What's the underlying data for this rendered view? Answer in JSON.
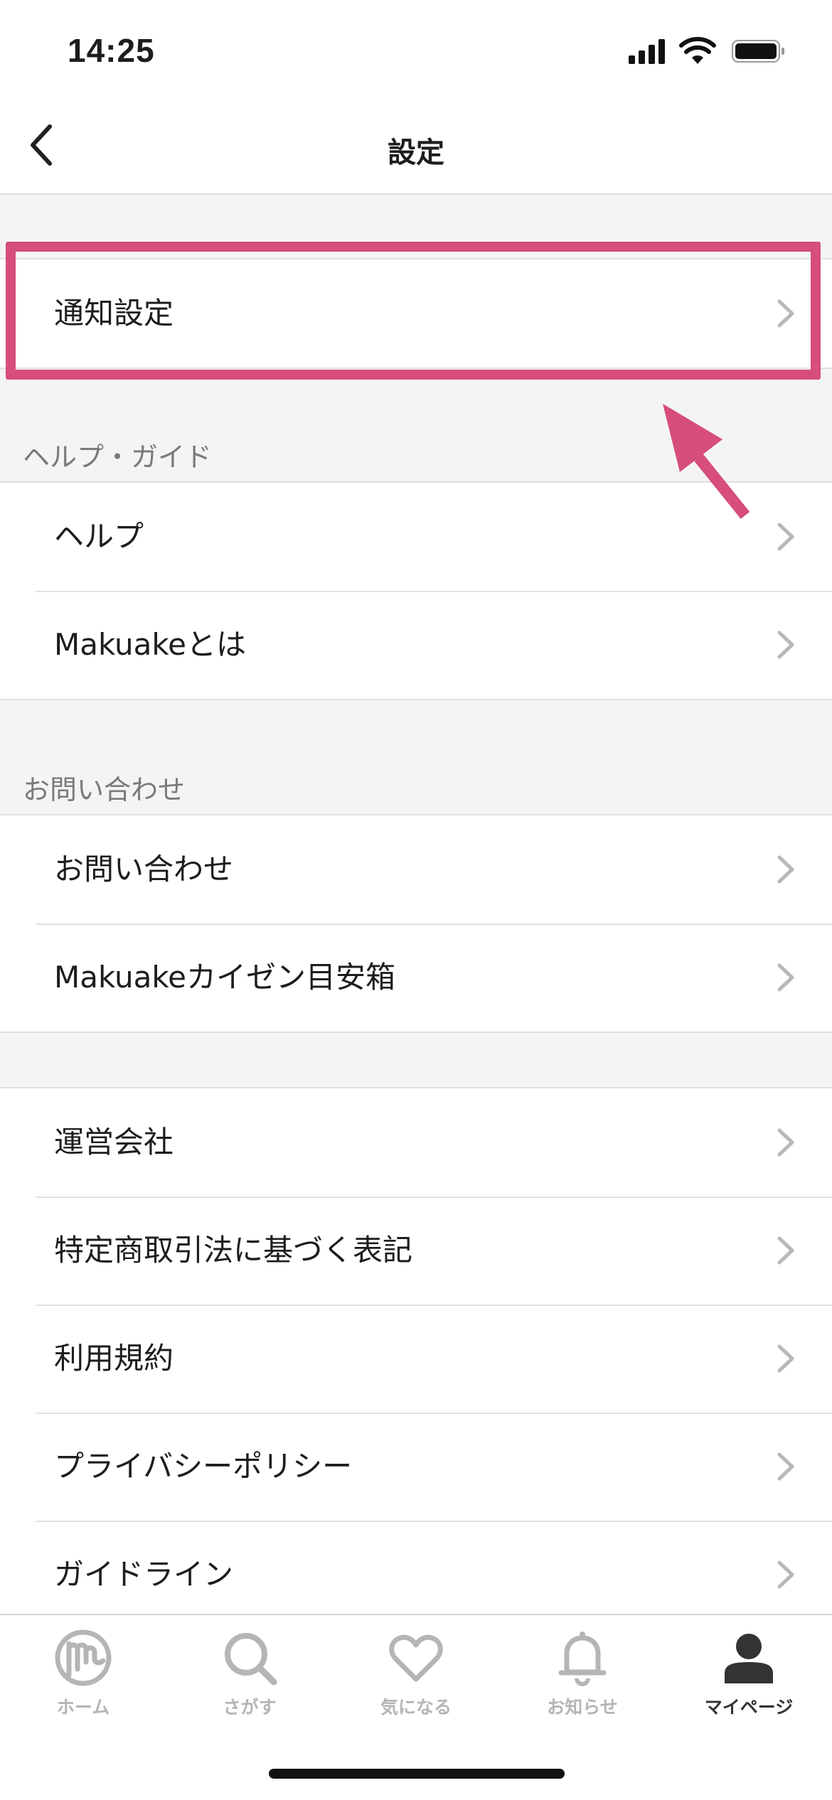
{
  "status_bar": {
    "time": "14:25"
  },
  "nav": {
    "title": "設定"
  },
  "groups": [
    {
      "header": "",
      "items": [
        {
          "label": "通知設定"
        }
      ]
    },
    {
      "header": "ヘルプ・ガイド",
      "items": [
        {
          "label": "ヘルプ"
        },
        {
          "label": "Makuakeとは"
        }
      ]
    },
    {
      "header": "お問い合わせ",
      "items": [
        {
          "label": "お問い合わせ"
        },
        {
          "label": "Makuakeカイゼン目安箱"
        }
      ]
    },
    {
      "header": "",
      "items": [
        {
          "label": "運営会社"
        },
        {
          "label": "特定商取引法に基づく表記"
        },
        {
          "label": "利用規約"
        },
        {
          "label": "プライバシーポリシー"
        },
        {
          "label": "ガイドライン"
        }
      ]
    }
  ],
  "tabs": [
    {
      "label": "ホーム",
      "icon": "makuake-logo-icon",
      "active": false
    },
    {
      "label": "さがす",
      "icon": "search-icon",
      "active": false
    },
    {
      "label": "気になる",
      "icon": "heart-icon",
      "active": false
    },
    {
      "label": "お知らせ",
      "icon": "bell-icon",
      "active": false
    },
    {
      "label": "マイページ",
      "icon": "person-icon",
      "active": true
    }
  ],
  "colors": {
    "highlight": "#d64d7e",
    "tab_inactive": "#b5b5b5",
    "tab_active": "#333333"
  }
}
